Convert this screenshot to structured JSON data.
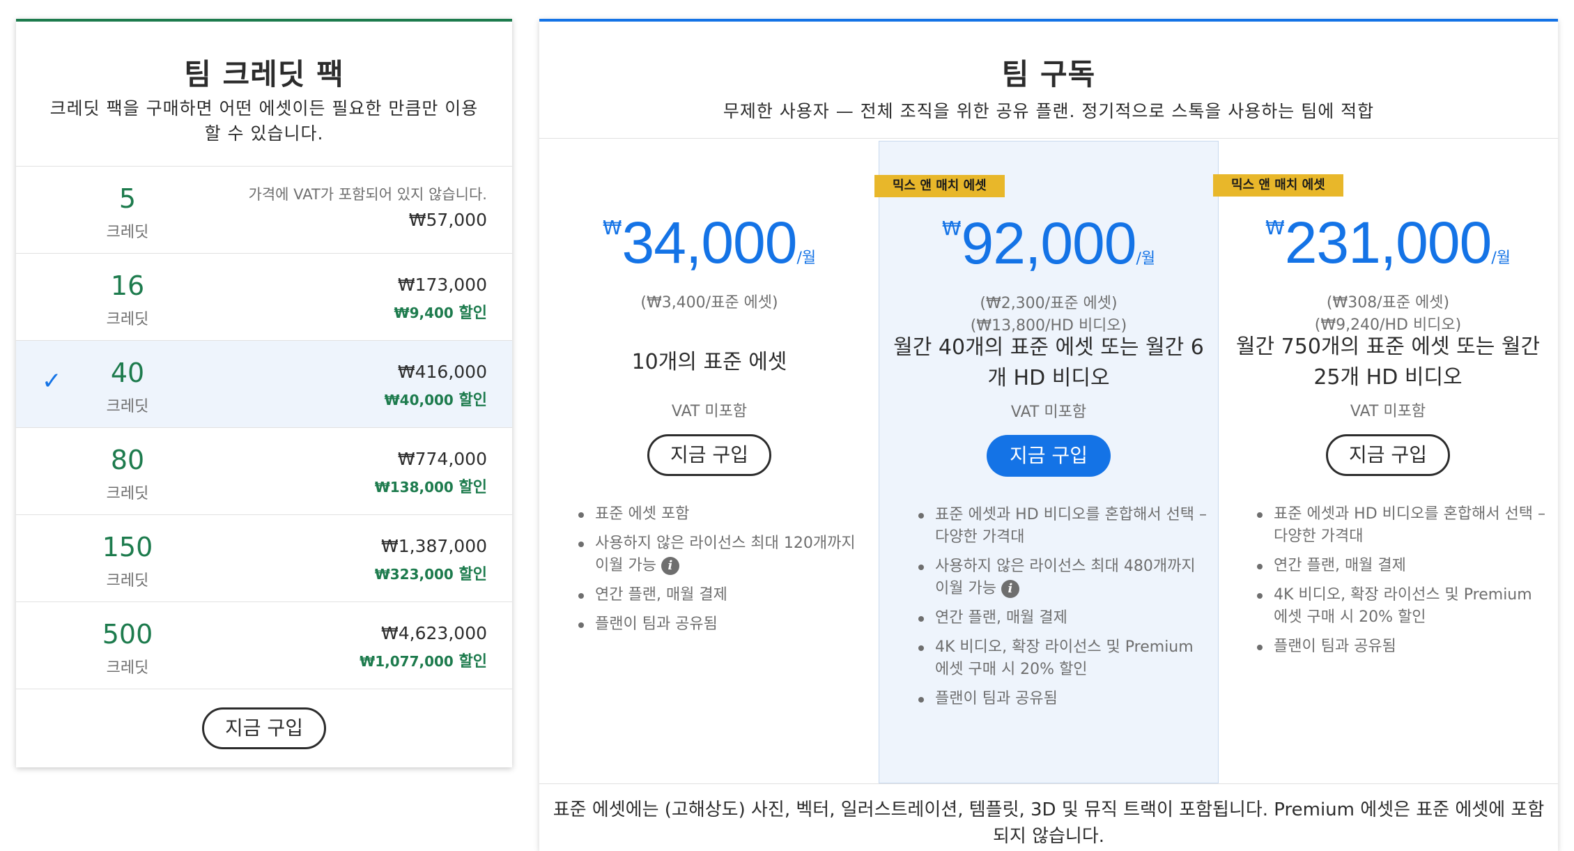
{
  "credit_pack": {
    "title": "팀 크레딧 팩",
    "subtitle": "크레딧 팩을 구매하면 어떤 에셋이든 필요한 만큼만 이용할 수 있습니다.",
    "vat_note": "가격에 VAT가 포함되어 있지 않습니다.",
    "unit_label": "크레딧",
    "discount_suffix": "할인",
    "selected_check": "✓",
    "rows": [
      {
        "credits": "5",
        "price": "₩57,000",
        "discount": ""
      },
      {
        "credits": "16",
        "price": "₩173,000",
        "discount": "₩9,400"
      },
      {
        "credits": "40",
        "price": "₩416,000",
        "discount": "₩40,000",
        "selected": true
      },
      {
        "credits": "80",
        "price": "₩774,000",
        "discount": "₩138,000"
      },
      {
        "credits": "150",
        "price": "₩1,387,000",
        "discount": "₩323,000"
      },
      {
        "credits": "500",
        "price": "₩4,623,000",
        "discount": "₩1,077,000"
      }
    ],
    "buy_label": "지금 구입"
  },
  "subscription": {
    "title": "팀 구독",
    "subtitle": "무제한 사용자 — 전체 조직을 위한 공유 플랜. 정기적으로 스톡을 사용하는 팀에 적합",
    "currency": "₩",
    "per": "/월",
    "vat_label": "VAT 미포함",
    "info_icon": "i",
    "plans": [
      {
        "badge": "",
        "price": "34,000",
        "unit_prices": [
          "(₩3,400/표준 에셋)"
        ],
        "desc": "10개의 표준 에셋",
        "buy_label": "지금 구입",
        "features": [
          "표준 에셋 포함",
          "사용하지 않은 라이선스 최대 120개까지 이월 가능",
          "연간 플랜, 매월 결제",
          "플랜이 팀과 공유됨"
        ]
      },
      {
        "badge": "믹스 앤 매치 에셋",
        "price": "92,000",
        "unit_prices": [
          "(₩2,300/표준 에셋)",
          "(₩13,800/HD 비디오)"
        ],
        "desc": "월간 40개의 표준 에셋 또는 월간 6개 HD 비디오",
        "buy_label": "지금 구입",
        "features": [
          "표준 에셋과 HD 비디오를 혼합해서 선택 – 다양한 가격대",
          "사용하지 않은 라이선스 최대 480개까지 이월 가능",
          "연간 플랜, 매월 결제",
          "4K 비디오, 확장 라이선스 및 Premium 에셋 구매 시 20% 할인",
          "플랜이 팀과 공유됨"
        ]
      },
      {
        "badge": "믹스 앤 매치 에셋",
        "price": "231,000",
        "unit_prices": [
          "(₩308/표준 에셋)",
          "(₩9,240/HD 비디오)"
        ],
        "desc": "월간 750개의 표준 에셋 또는 월간 25개 HD 비디오",
        "buy_label": "지금 구입",
        "features": [
          "표준 에셋과 HD 비디오를 혼합해서 선택 – 다양한 가격대",
          "연간 플랜, 매월 결제",
          "4K 비디오, 확장 라이선스 및 Premium 에셋 구매 시 20% 할인",
          "플랜이 팀과 공유됨"
        ]
      }
    ],
    "footnote": "표준 에셋에는 (고해상도) 사진, 벡터, 일러스트레이션, 템플릿, 3D 및 뮤직 트랙이 포함됩니다. Premium 에셋은 표준 에셋에 포함되지 않습니다."
  },
  "colors": {
    "green": "#1d7b4d",
    "blue": "#1473e6",
    "badge": "#e8b72a"
  }
}
